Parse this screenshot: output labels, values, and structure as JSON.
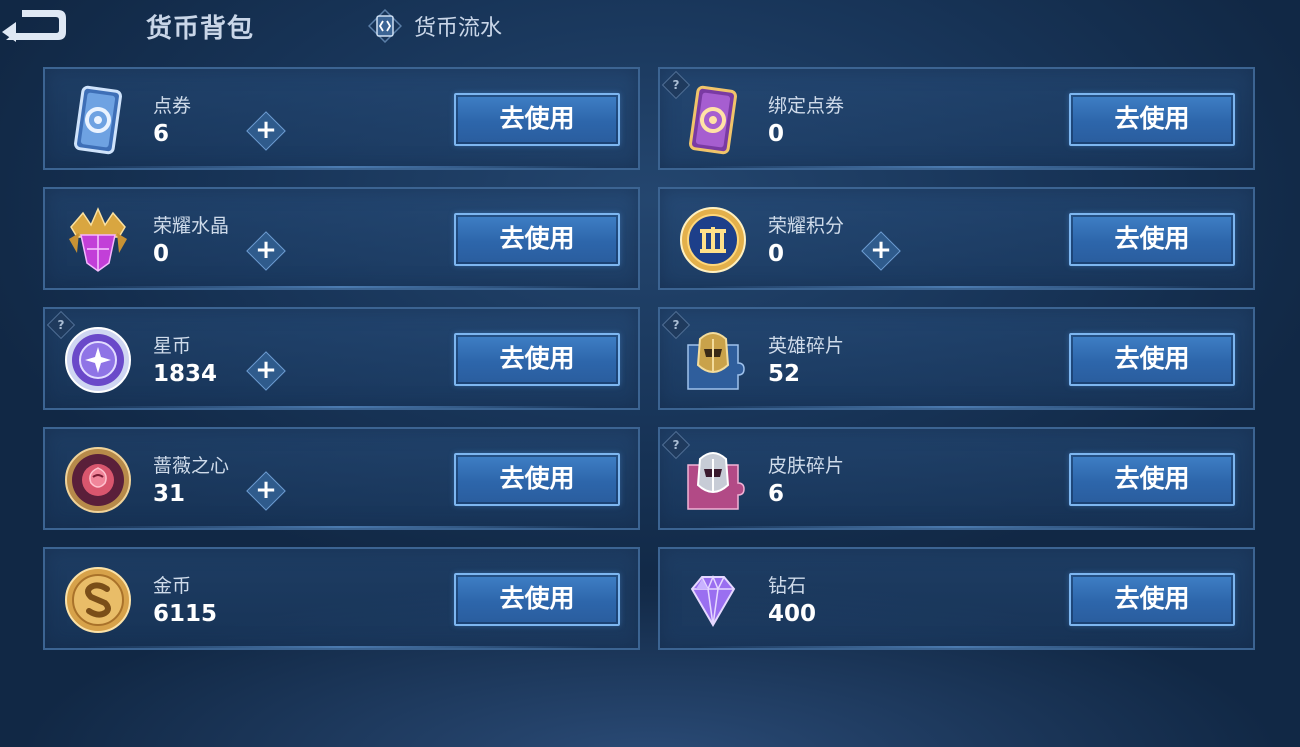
{
  "header": {
    "title": "货币背包",
    "ledger_tab_label": "货币流水"
  },
  "accent_color": "#7db6f0",
  "currencies": [
    {
      "name": "点券",
      "amount": "6",
      "has_plus": true,
      "has_help": false,
      "icon": "voucher-card-icon",
      "button": "去使用"
    },
    {
      "name": "绑定点券",
      "amount": "0",
      "has_plus": false,
      "has_help": true,
      "icon": "bound-voucher-card-icon",
      "button": "去使用"
    },
    {
      "name": "荣耀水晶",
      "amount": "0",
      "has_plus": true,
      "has_help": false,
      "icon": "glory-crystal-icon",
      "button": "去使用"
    },
    {
      "name": "荣耀积分",
      "amount": "0",
      "has_plus": true,
      "has_help": false,
      "icon": "glory-points-icon",
      "button": "去使用"
    },
    {
      "name": "星币",
      "amount": "1834",
      "has_plus": true,
      "has_help": true,
      "icon": "star-coin-icon",
      "button": "去使用"
    },
    {
      "name": "英雄碎片",
      "amount": "52",
      "has_plus": false,
      "has_help": true,
      "icon": "hero-shard-icon",
      "button": "去使用"
    },
    {
      "name": "蔷薇之心",
      "amount": "31",
      "has_plus": true,
      "has_help": false,
      "icon": "rose-heart-icon",
      "button": "去使用"
    },
    {
      "name": "皮肤碎片",
      "amount": "6",
      "has_plus": false,
      "has_help": true,
      "icon": "skin-shard-icon",
      "button": "去使用"
    },
    {
      "name": "金币",
      "amount": "6115",
      "has_plus": false,
      "has_help": false,
      "icon": "gold-coin-icon",
      "button": "去使用"
    },
    {
      "name": "钻石",
      "amount": "400",
      "has_plus": false,
      "has_help": false,
      "icon": "diamond-icon",
      "button": "去使用"
    }
  ],
  "help_glyph": "?",
  "plus_glyph": "+"
}
